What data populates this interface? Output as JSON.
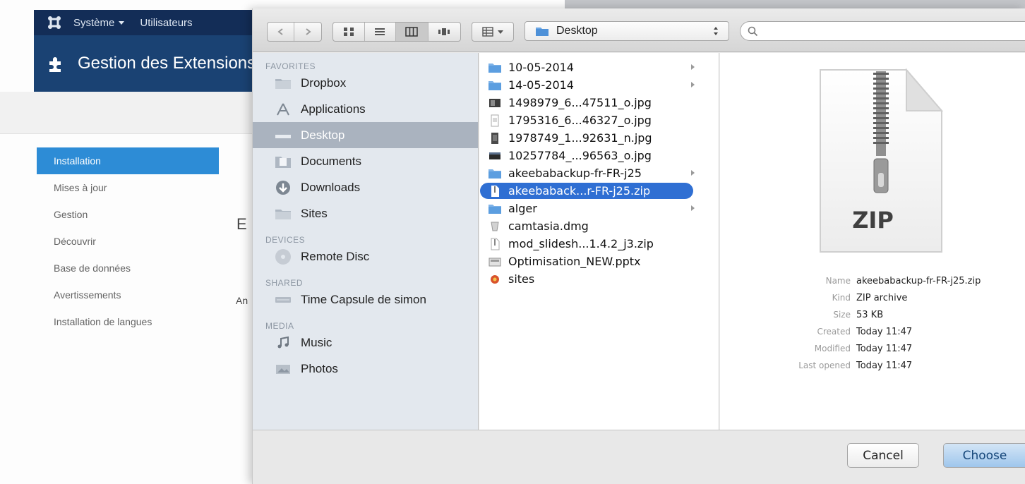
{
  "joomla": {
    "menu": [
      "Système",
      "Utilisateurs"
    ],
    "page_title": "Gestion des Extensions",
    "sidebar": [
      {
        "label": "Installation",
        "active": true
      },
      {
        "label": "Mises à jour"
      },
      {
        "label": "Gestion"
      },
      {
        "label": "Découvrir"
      },
      {
        "label": "Base de données"
      },
      {
        "label": "Avertissements"
      },
      {
        "label": "Installation de langues"
      }
    ],
    "content_fragments": [
      "E",
      "An"
    ]
  },
  "dialog": {
    "location": "Desktop",
    "search_placeholder": "",
    "sidebar": [
      {
        "type": "section",
        "label": "FAVORITES"
      },
      {
        "type": "item",
        "label": "Dropbox",
        "icon": "folder-icon"
      },
      {
        "type": "item",
        "label": "Applications",
        "icon": "applications-icon"
      },
      {
        "type": "item",
        "label": "Desktop",
        "icon": "desktop-icon",
        "selected": true
      },
      {
        "type": "item",
        "label": "Documents",
        "icon": "documents-icon"
      },
      {
        "type": "item",
        "label": "Downloads",
        "icon": "downloads-icon"
      },
      {
        "type": "item",
        "label": "Sites",
        "icon": "folder-icon"
      },
      {
        "type": "section",
        "label": "DEVICES"
      },
      {
        "type": "item",
        "label": "Remote Disc",
        "icon": "disc-icon"
      },
      {
        "type": "section",
        "label": "SHARED"
      },
      {
        "type": "item",
        "label": "Time Capsule de simon",
        "icon": "time-capsule-icon"
      },
      {
        "type": "section",
        "label": "MEDIA"
      },
      {
        "type": "item",
        "label": "Music",
        "icon": "music-icon"
      },
      {
        "type": "item",
        "label": "Photos",
        "icon": "photos-icon"
      }
    ],
    "files": [
      {
        "name": "10-05-2014",
        "kind": "folder",
        "has_children": true
      },
      {
        "name": "14-05-2014",
        "kind": "folder",
        "has_children": true
      },
      {
        "name": "1498979_6...47511_o.jpg",
        "kind": "image"
      },
      {
        "name": "1795316_6...46327_o.jpg",
        "kind": "image"
      },
      {
        "name": "1978749_1...92631_n.jpg",
        "kind": "image"
      },
      {
        "name": "10257784_...96563_o.jpg",
        "kind": "image"
      },
      {
        "name": "akeebabackup-fr-FR-j25",
        "kind": "folder",
        "has_children": true
      },
      {
        "name": "akeebaback...r-FR-j25.zip",
        "kind": "zip",
        "selected": true
      },
      {
        "name": "alger",
        "kind": "folder",
        "has_children": true
      },
      {
        "name": "camtasia.dmg",
        "kind": "dmg"
      },
      {
        "name": "mod_slidesh...1.4.2_j3.zip",
        "kind": "zip"
      },
      {
        "name": "Optimisation_NEW.pptx",
        "kind": "pptx"
      },
      {
        "name": "sites",
        "kind": "app"
      }
    ],
    "preview": {
      "icon_label": "ZIP",
      "info": [
        {
          "key": "Name",
          "value": "akeebabackup-fr-FR-j25.zip"
        },
        {
          "key": "Kind",
          "value": "ZIP archive"
        },
        {
          "key": "Size",
          "value": "53 KB"
        },
        {
          "key": "Created",
          "value": "Today 11:47"
        },
        {
          "key": "Modified",
          "value": "Today 11:47"
        },
        {
          "key": "Last opened",
          "value": "Today 11:47"
        }
      ]
    },
    "buttons": {
      "cancel": "Cancel",
      "choose": "Choose"
    }
  }
}
